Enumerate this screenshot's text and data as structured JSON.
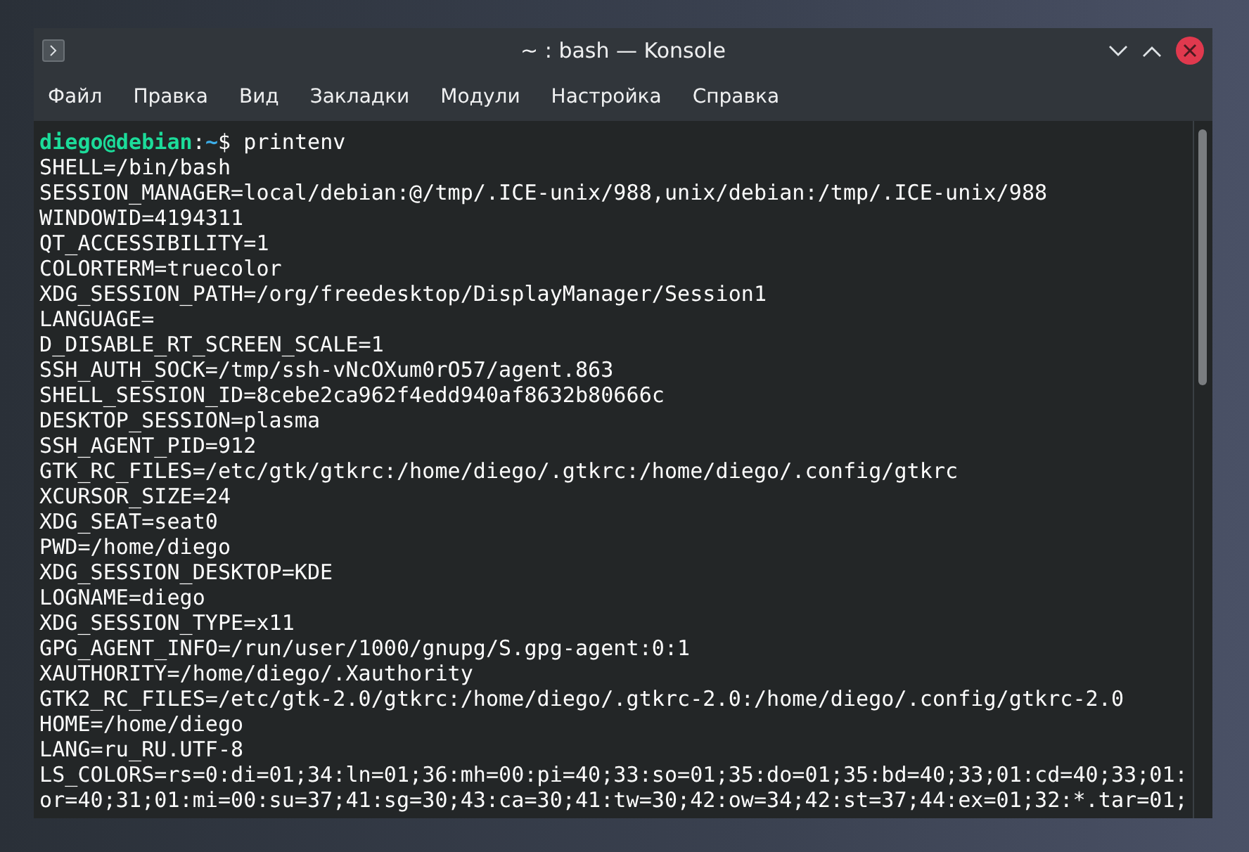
{
  "window": {
    "title": "~ : bash — Konsole"
  },
  "menu": [
    "Файл",
    "Правка",
    "Вид",
    "Закладки",
    "Модули",
    "Настройка",
    "Справка"
  ],
  "terminal": {
    "prompt": {
      "user_host": "diego@debian",
      "separator": ":",
      "cwd": "~",
      "symbol": "$",
      "command": "printenv"
    },
    "lines": [
      "SHELL=/bin/bash",
      "SESSION_MANAGER=local/debian:@/tmp/.ICE-unix/988,unix/debian:/tmp/.ICE-unix/988",
      "WINDOWID=4194311",
      "QT_ACCESSIBILITY=1",
      "COLORTERM=truecolor",
      "XDG_SESSION_PATH=/org/freedesktop/DisplayManager/Session1",
      "LANGUAGE=",
      "D_DISABLE_RT_SCREEN_SCALE=1",
      "SSH_AUTH_SOCK=/tmp/ssh-vNcOXum0rO57/agent.863",
      "SHELL_SESSION_ID=8cebe2ca962f4edd940af8632b80666c",
      "DESKTOP_SESSION=plasma",
      "SSH_AGENT_PID=912",
      "GTK_RC_FILES=/etc/gtk/gtkrc:/home/diego/.gtkrc:/home/diego/.config/gtkrc",
      "XCURSOR_SIZE=24",
      "XDG_SEAT=seat0",
      "PWD=/home/diego",
      "XDG_SESSION_DESKTOP=KDE",
      "LOGNAME=diego",
      "XDG_SESSION_TYPE=x11",
      "GPG_AGENT_INFO=/run/user/1000/gnupg/S.gpg-agent:0:1",
      "XAUTHORITY=/home/diego/.Xauthority",
      "GTK2_RC_FILES=/etc/gtk-2.0/gtkrc:/home/diego/.gtkrc-2.0:/home/diego/.config/gtkrc-2.0",
      "HOME=/home/diego",
      "LANG=ru_RU.UTF-8",
      "LS_COLORS=rs=0:di=01;34:ln=01;36:mh=00:pi=40;33:so=01;35:do=01;35:bd=40;33;01:cd=40;33;01:",
      "or=40;31;01:mi=00:su=37;41:sg=30;43:ca=30;41:tw=30;42:ow=34;42:st=37;44:ex=01;32:*.tar=01;"
    ]
  }
}
